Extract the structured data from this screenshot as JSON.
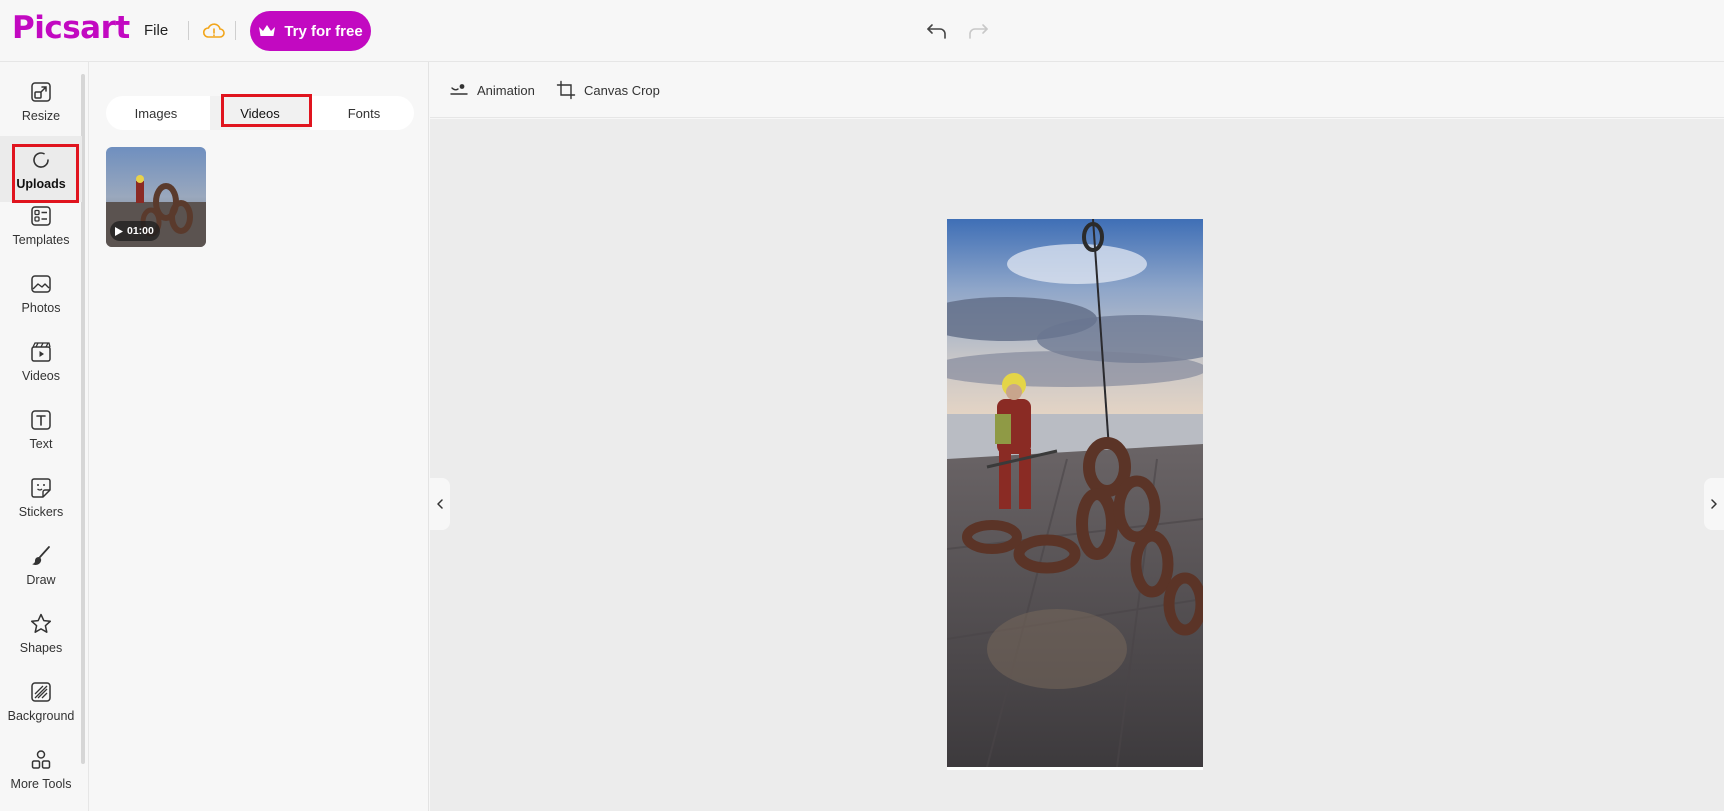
{
  "header": {
    "logo": "Picsart",
    "file_menu": "File",
    "try_button": "Try for free"
  },
  "sidebar": {
    "items": [
      {
        "label": "Resize",
        "icon": "resize-icon"
      },
      {
        "label": "Uploads",
        "icon": "uploads-icon"
      },
      {
        "label": "Templates",
        "icon": "templates-icon"
      },
      {
        "label": "Photos",
        "icon": "photos-icon"
      },
      {
        "label": "Videos",
        "icon": "videos-icon"
      },
      {
        "label": "Text",
        "icon": "text-icon"
      },
      {
        "label": "Stickers",
        "icon": "stickers-icon"
      },
      {
        "label": "Draw",
        "icon": "draw-icon"
      },
      {
        "label": "Shapes",
        "icon": "shapes-icon"
      },
      {
        "label": "Background",
        "icon": "background-icon"
      },
      {
        "label": "More Tools",
        "icon": "more-tools-icon"
      }
    ],
    "active": "Uploads"
  },
  "panel": {
    "tabs": [
      {
        "label": "Images"
      },
      {
        "label": "Videos"
      },
      {
        "label": "Fonts"
      }
    ],
    "active_tab": "Videos",
    "videos": [
      {
        "duration": "01:00"
      }
    ]
  },
  "toolbar": {
    "animation": "Animation",
    "canvas_crop": "Canvas Crop"
  },
  "colors": {
    "brand": "#c209c1",
    "highlight": "#e0141e"
  }
}
